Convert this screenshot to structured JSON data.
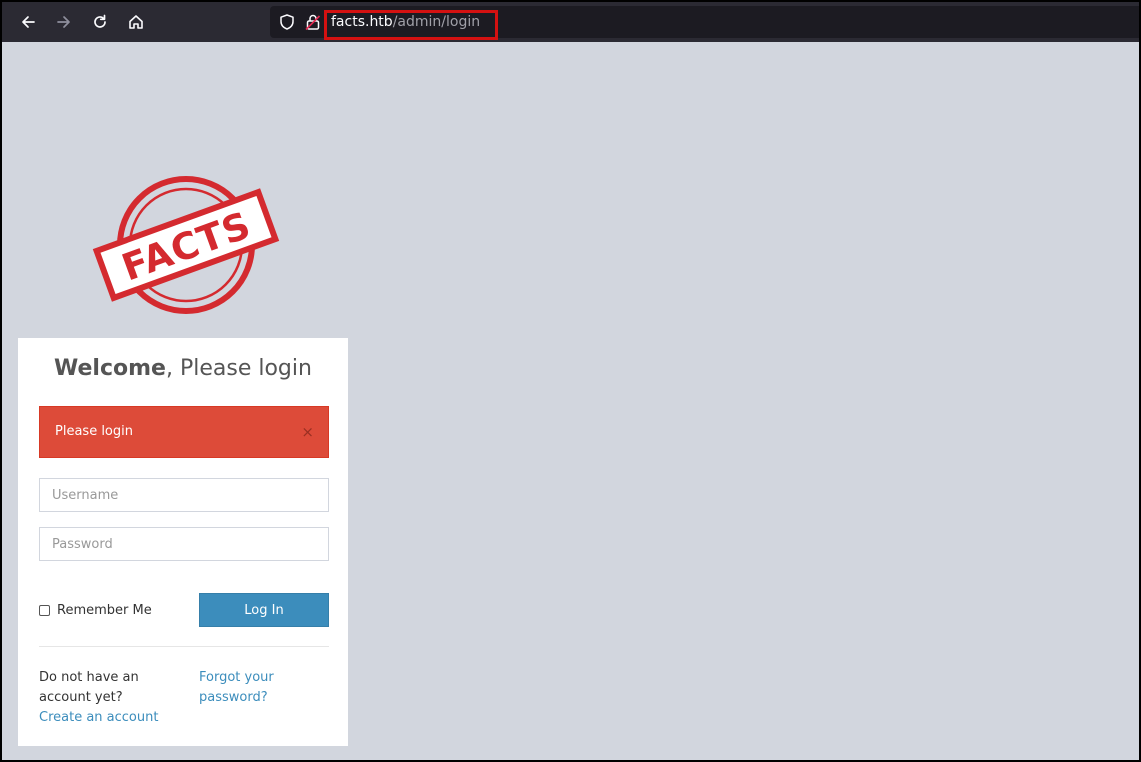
{
  "browser": {
    "url_host": "facts.htb",
    "url_path": "/admin/login",
    "icons": {
      "back": "arrow-left-icon",
      "forward": "arrow-right-icon",
      "reload": "reload-icon",
      "home": "home-icon",
      "tracking": "shield-icon",
      "security": "lock-icon"
    }
  },
  "logo": {
    "text": "FACTS",
    "color": "#d42a2f"
  },
  "login": {
    "title_bold": "Welcome",
    "title_rest": ", Please login",
    "alert_text": "Please login",
    "alert_close": "×",
    "username_placeholder": "Username",
    "password_placeholder": "Password",
    "remember_label": "Remember Me",
    "submit_label": "Log In",
    "no_account_line1": "Do not have an",
    "no_account_line2": "account yet?",
    "create_account": "Create an account",
    "forgot_line1": "Forgot your",
    "forgot_line2": "password?"
  },
  "colors": {
    "page_bg": "#d2d6de",
    "alert_bg": "#dd4b39",
    "primary": "#3c8dbc",
    "toolbar_bg": "#2b2a33",
    "highlight": "#d41111"
  }
}
